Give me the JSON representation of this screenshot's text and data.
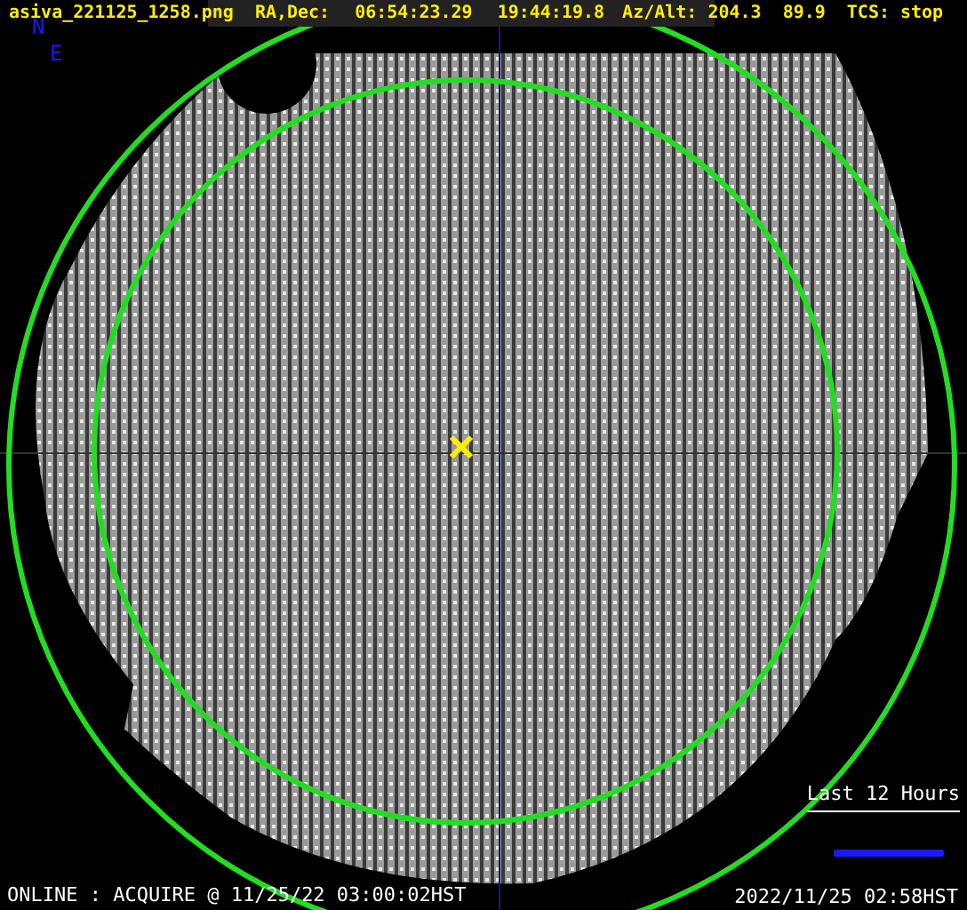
{
  "header": {
    "filename": "asiva_221125_1258.png",
    "ra_dec_label": "RA,Dec:",
    "ra": "06:54:23.29",
    "dec": "19:44:19.8",
    "az_alt_label": "Az/Alt:",
    "az": "204.3",
    "alt": "89.9",
    "tcs_label": "TCS:",
    "tcs": "stop"
  },
  "compass": [
    "N",
    "E"
  ],
  "legend": {
    "label": "Last 12 Hours"
  },
  "status": "ONLINE : ACQUIRE @ 11/25/22 03:00:02HST",
  "timestamp": "2022/11/25 02:58HST"
}
